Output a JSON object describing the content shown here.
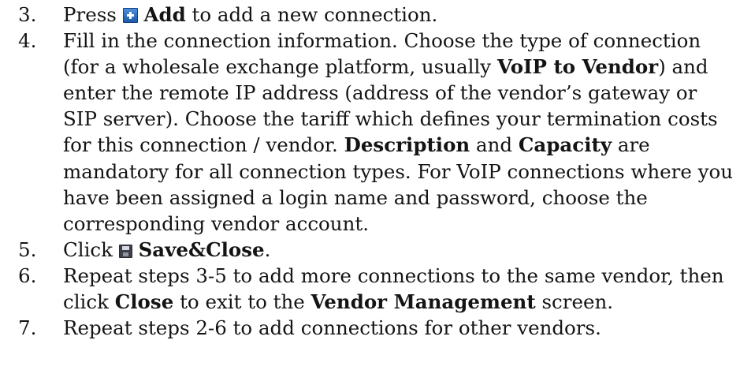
{
  "steps": [
    {
      "number": "3.",
      "text_before": "Press ",
      "icon": "add-plus-icon",
      "bold_label": "Add",
      "text_after": " to add a new connection."
    },
    {
      "number": "4.",
      "p1": "Fill in the connection information. Choose the type of connection (for a wholesale exchange platform, usually ",
      "b1": "VoIP to Vendor",
      "p2": ") and enter the remote IP address (address of the vendor’s gateway or SIP server). Choose the tariff which defines your termination costs for this connection / vendor. ",
      "b2": "Description",
      "p3": " and ",
      "b3": "Capacity",
      "p4": " are mandatory for all connection types. For VoIP connections where you have been assigned a login name and password, choose the corresponding vendor account."
    },
    {
      "number": "5.",
      "text_before": "Click ",
      "icon": "save-disk-icon",
      "bold_label": "Save&Close",
      "text_after": "."
    },
    {
      "number": "6.",
      "p1": "Repeat steps 3-5 to add more connections to the same vendor, then click ",
      "b1": "Close",
      "p2": " to exit to the ",
      "b2": "Vendor Management",
      "p3": " screen."
    },
    {
      "number": "7.",
      "text": "Repeat steps 2-6 to add connections for other vendors."
    }
  ]
}
